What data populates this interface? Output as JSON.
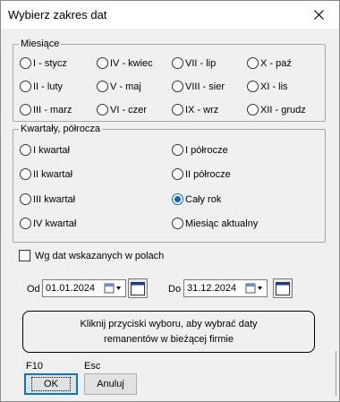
{
  "window": {
    "title": "Wybierz zakres dat"
  },
  "months": {
    "legend": "Miesiące",
    "items": [
      "I - stycz",
      "IV - kwiec",
      "VII - lip",
      "X - paź",
      "II - luty",
      "V - maj",
      "VIII - sier",
      "XI - lis",
      "III - marz",
      "VI -  czer",
      "IX - wrz",
      "XII - grudz"
    ]
  },
  "periods": {
    "legend": "Kwartały, półrocza",
    "items": [
      "I kwartał",
      "I półrocze",
      "II kwartał",
      "II półrocze",
      "III kwartał",
      "Cały rok",
      "IV kwartał",
      "Miesiąc aktualny"
    ],
    "selected": "Cały rok"
  },
  "range_checkbox": {
    "label": "Wg dat wskazanych w polach",
    "checked": false
  },
  "from": {
    "label": "Od",
    "value": "01.01.2024"
  },
  "to": {
    "label": "Do",
    "value": "31.12.2024"
  },
  "info": {
    "line1": "Kliknij przyciski wyboru, aby wybrać daty",
    "line2": "remanentów w bieżącej firmie"
  },
  "buttons": {
    "ok_hotkey": "F10",
    "ok_label": "OK",
    "cancel_hotkey": "Esc",
    "cancel_label": "Anuluj"
  },
  "colors": {
    "selected_radio": "#0a64d4",
    "background": "#f0f0f0"
  }
}
